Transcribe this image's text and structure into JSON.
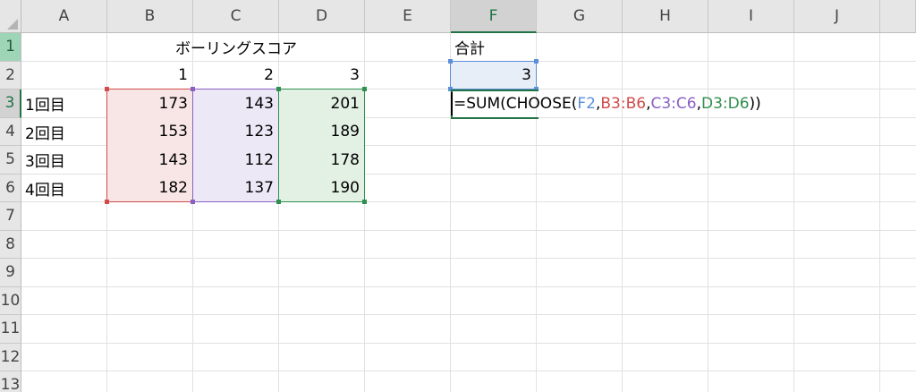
{
  "columns": [
    "A",
    "B",
    "C",
    "D",
    "E",
    "F",
    "G",
    "H",
    "I",
    "J"
  ],
  "rows": [
    "1",
    "2",
    "3",
    "4",
    "5",
    "6",
    "7",
    "8",
    "9",
    "10",
    "11",
    "12",
    "13"
  ],
  "cells": {
    "B1": "ボーリングスコア",
    "F1": "合計",
    "B2": "1",
    "C2": "2",
    "D2": "3",
    "F2": "3",
    "A3": "1回目",
    "A4": "2回目",
    "A5": "3回目",
    "A6": "4回目",
    "B3": "173",
    "C3": "143",
    "D3": "201",
    "B4": "153",
    "C4": "123",
    "D4": "189",
    "B5": "143",
    "C5": "112",
    "D5": "178",
    "B6": "182",
    "C6": "137",
    "D6": "190"
  },
  "formula": {
    "cell": "F3",
    "parts": [
      {
        "text": "=SUM(CHOOSE(",
        "color": "#000000"
      },
      {
        "text": "F2",
        "color": "#5b8fd8"
      },
      {
        "text": ",",
        "color": "#000000"
      },
      {
        "text": "B3:B6",
        "color": "#d24a4a"
      },
      {
        "text": ",",
        "color": "#000000"
      },
      {
        "text": "C3:C6",
        "color": "#8a5fc4"
      },
      {
        "text": ",",
        "color": "#000000"
      },
      {
        "text": "D3:D6",
        "color": "#2f8f4e"
      },
      {
        "text": "))",
        "color": "#000000"
      }
    ]
  },
  "colors": {
    "accent_green": "#217346",
    "ref_blue": "#5b8fd8",
    "ref_red": "#d24a4a",
    "ref_purple": "#8a5fc4",
    "ref_green": "#2f8f4e",
    "fill_blue": "#e8eef8",
    "fill_red": "#f8e6e6",
    "fill_purple": "#ece8f6",
    "fill_green": "#e3f1e5"
  },
  "active_column": "F",
  "active_row": "3",
  "highlight_row": "1"
}
